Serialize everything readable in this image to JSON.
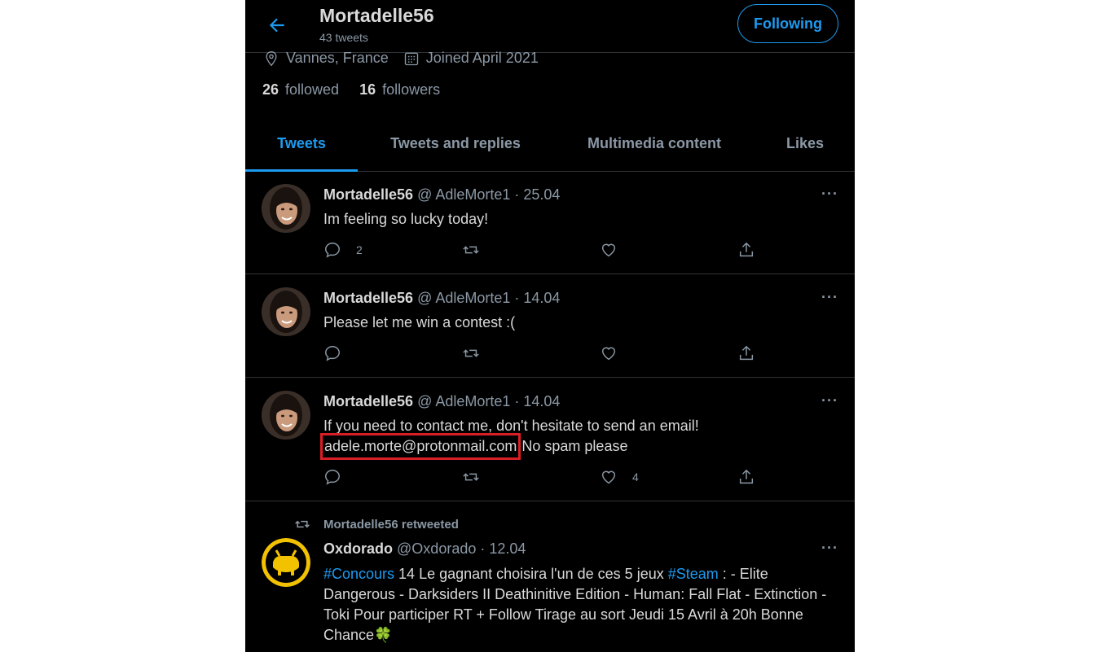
{
  "header": {
    "title": "Mortadelle56",
    "tweet_count": "43 tweets",
    "follow_label": "Following"
  },
  "profile": {
    "location": "Vannes, France",
    "joined": "Joined April 2021",
    "followed_count": "26",
    "followed_label": "followed",
    "followers_count": "16",
    "followers_label": "followers"
  },
  "tabs": [
    {
      "label": "Tweets",
      "active": true
    },
    {
      "label": "Tweets and replies",
      "active": false
    },
    {
      "label": "Multimedia content",
      "active": false
    },
    {
      "label": "Likes",
      "active": false
    }
  ],
  "tweets": [
    {
      "name": "Mortadelle56",
      "handle": "@ AdleMorte1",
      "date": "· 25.04",
      "text": "Im feeling so lucky today!",
      "reply_count": "2",
      "like_count": ""
    },
    {
      "name": "Mortadelle56",
      "handle": "@ AdleMorte1",
      "date": "· 14.04",
      "text": "Please let me win a contest :(",
      "reply_count": "",
      "like_count": ""
    },
    {
      "name": "Mortadelle56",
      "handle": "@ AdleMorte1",
      "date": "· 14.04",
      "text_line1": "If you need to contact me, don't hesitate to send an email!",
      "email": "adele.morte@protonmail.com",
      "text_after_email": "No spam please",
      "reply_count": "",
      "like_count": "4"
    }
  ],
  "retweet": {
    "label": "Mortadelle56 retweeted",
    "name": "Oxdorado",
    "handle": "@Oxdorado",
    "date": "· 12.04",
    "hashtag1": "#Concours",
    "text1": " 14 Le gagnant choisira l'un de ces 5 jeux ",
    "hashtag2": "#Steam",
    "text2": " : - Elite Dangerous - Darksiders II Deathinitive Edition - Human: Fall Flat - Extinction - Toki Pour participer RT + Follow Tirage au sort Jeudi 15 Avril à 20h Bonne Chance",
    "emoji": "🍀"
  },
  "more_label": "···",
  "colors": {
    "accent": "#1d9bf0",
    "highlight_box": "#d91f26",
    "background": "#000000"
  },
  "icons": [
    "back-arrow-icon",
    "location-icon",
    "calendar-icon",
    "reply-icon",
    "retweet-icon",
    "like-icon",
    "share-icon",
    "more-icon"
  ]
}
